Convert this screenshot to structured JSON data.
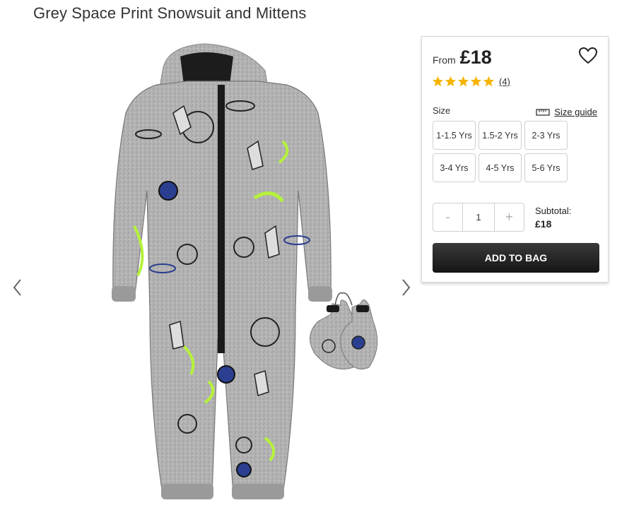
{
  "product": {
    "title": "Grey Space Print Snowsuit and Mittens",
    "image_alt": "Grey space print snowsuit with matching mittens"
  },
  "gallery": {
    "prev_icon": "chevron-left-icon",
    "next_icon": "chevron-right-icon"
  },
  "pricing": {
    "from_label": "From",
    "price": "£18"
  },
  "wishlist": {
    "icon": "heart-icon"
  },
  "rating": {
    "stars": 5,
    "max_stars": 5,
    "star_color": "#f5b400",
    "review_count": "(4)"
  },
  "size": {
    "label": "Size",
    "guide_label": "Size guide",
    "guide_icon": "ruler-icon",
    "options": [
      "1-1.5 Yrs",
      "1.5-2 Yrs",
      "2-3 Yrs",
      "3-4 Yrs",
      "4-5 Yrs",
      "5-6 Yrs"
    ]
  },
  "quantity": {
    "decrement": "-",
    "value": "1",
    "increment": "+"
  },
  "subtotal": {
    "label": "Subtotal:",
    "value": "£18"
  },
  "add_to_bag": {
    "label": "ADD TO BAG",
    "color": "#222222"
  }
}
